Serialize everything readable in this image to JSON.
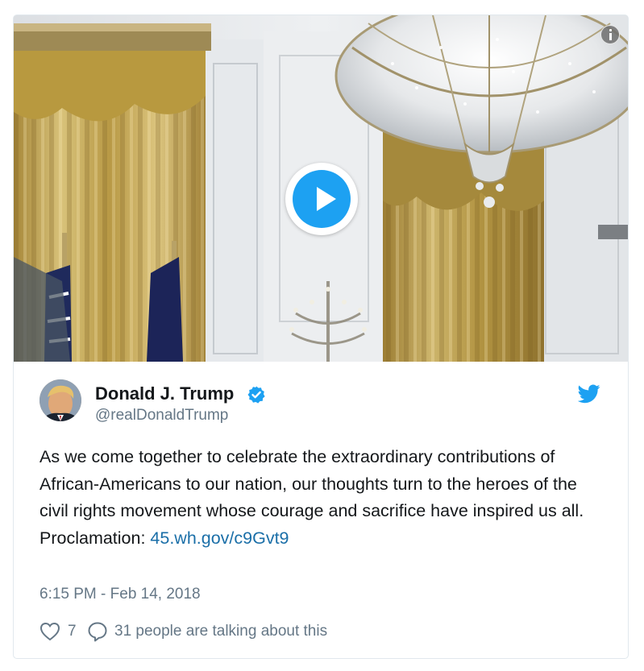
{
  "tweet": {
    "author": {
      "name": "Donald J. Trump",
      "handle": "@realDonaldTrump",
      "verified": true
    },
    "text": "As we come together to celebrate the extraordinary contributions of African-Americans to our nation, our thoughts turn to the heroes of the civil rights movement whose courage and sacrifice have inspired us all. Proclamation: ",
    "link": "45.wh.gov/c9Gvt9",
    "timestamp": "6:15 PM - Feb 14, 2018",
    "likes": "7",
    "talking": "31 people are talking about this"
  },
  "media": {
    "type": "video",
    "play_icon": "play-icon",
    "info_icon": "info-icon"
  },
  "icons": {
    "verified": "verified-badge-icon",
    "brand": "twitter-bird-icon",
    "like": "heart-icon",
    "reply": "speech-bubble-icon"
  },
  "colors": {
    "accent": "#1da1f2",
    "link": "#1b6fa8",
    "secondary_text": "#657786",
    "border": "#e1e8ed"
  }
}
